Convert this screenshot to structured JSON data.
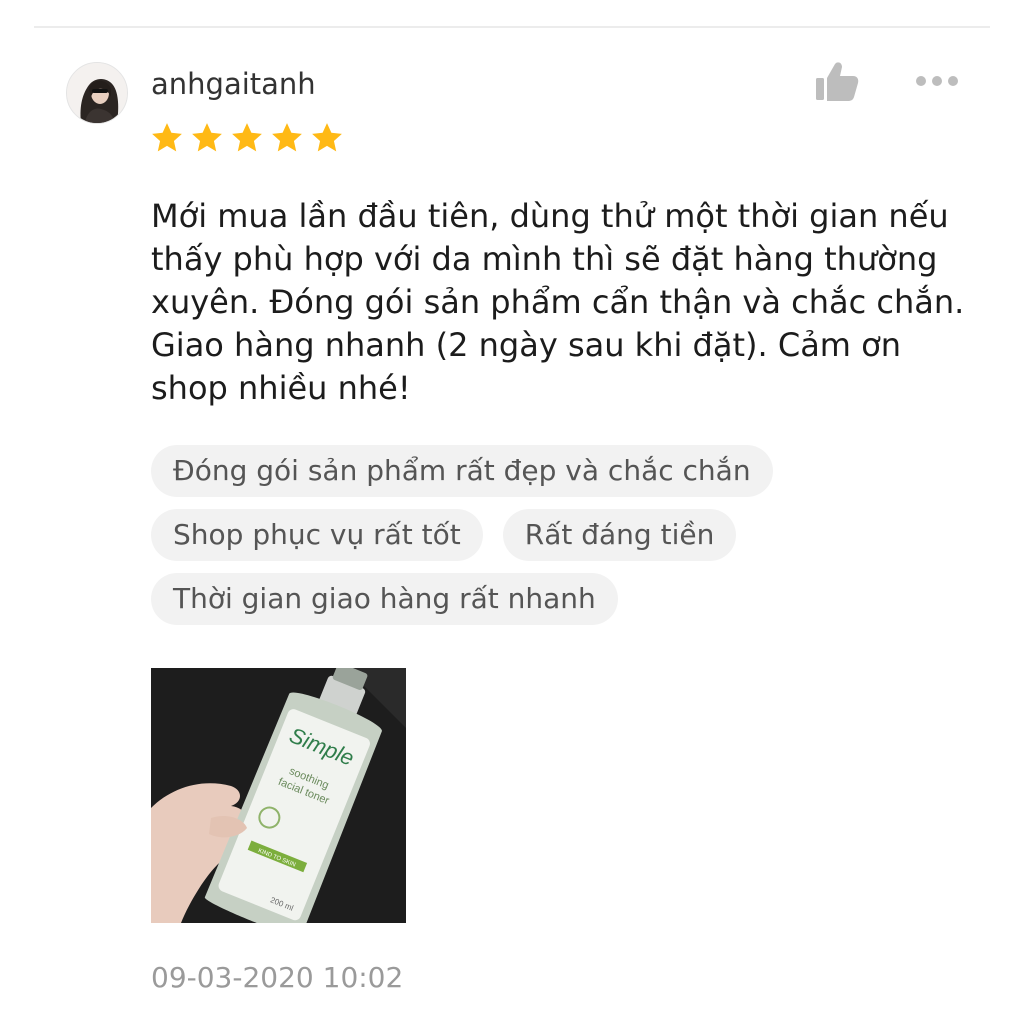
{
  "review": {
    "username": "anhgaitanh",
    "rating": 5,
    "text": "Mới mua lần đầu tiên, dùng thử một thời gian nếu thấy phù hợp với da mình thì sẽ đặt hàng thường xuyên. Đóng gói sản phẩm cẩn thận và chắc chắn. Giao hàng nhanh (2 ngày sau khi đặt). Cảm ơn shop nhiều nhé!",
    "tags": [
      "Đóng gói sản phẩm rất đẹp và chắc chắn",
      "Shop phục vụ rất tốt",
      "Rất đáng tiền",
      "Thời gian giao hàng rất nhanh"
    ],
    "photo": {
      "brand": "Simple",
      "product_line1": "soothing",
      "product_line2": "facial toner",
      "badge": "KIND TO SKIN",
      "volume": "200 ml"
    },
    "timestamp": "09-03-2020 10:02"
  },
  "icons": {
    "like": "thumbs-up-icon",
    "more": "more-dots-icon",
    "star": "star-icon"
  },
  "colors": {
    "star": "#FFB915",
    "icon": "#BDBDBD",
    "tag_bg": "#F2F2F2"
  }
}
